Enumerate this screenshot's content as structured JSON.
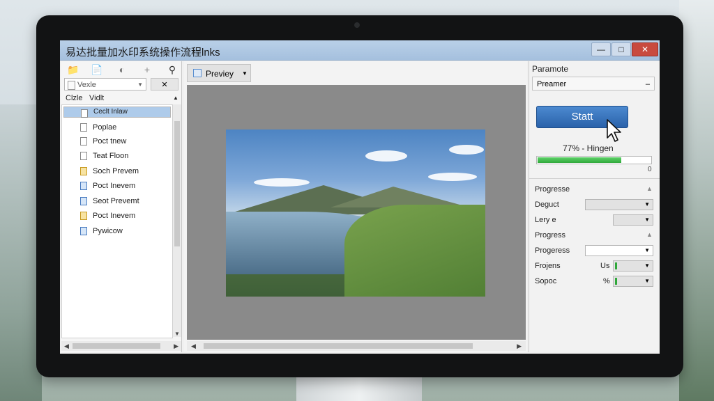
{
  "window": {
    "title": "易达批量加水印系统操作流程lnks",
    "min_label": "—",
    "max_label": "□",
    "close_label": "✕"
  },
  "left_panel": {
    "view_dropdown": "Vexle",
    "close_label": "✕",
    "col1": "Clzle",
    "col2": "Vidlt",
    "files": [
      {
        "label": "Ceclt Inlaw",
        "icon": "document-icon",
        "selected": true
      },
      {
        "label": "Poplae",
        "icon": "document-icon",
        "selected": false
      },
      {
        "label": "Poct tnew",
        "icon": "document-icon",
        "selected": false
      },
      {
        "label": "Teat Floon",
        "icon": "document-icon",
        "selected": false
      },
      {
        "label": "Soch Prevem",
        "icon": "image-file-icon",
        "selected": false
      },
      {
        "label": "Poct Inevem",
        "icon": "image-file-icon",
        "selected": false
      },
      {
        "label": "Seot Prevemt",
        "icon": "image-file-icon",
        "selected": false
      },
      {
        "label": "Poct Inevem",
        "icon": "image-file-icon",
        "selected": false
      },
      {
        "label": "Pywicow",
        "icon": "image-file-icon",
        "selected": false
      }
    ]
  },
  "center_panel": {
    "preview_tab": "Previey"
  },
  "right_panel": {
    "title": "Paramote",
    "param_dropdown": "Preamer",
    "start_button": "Statt",
    "progress_text": "77% - Hingen",
    "progress_fraction": 0.74,
    "progress_end": "0",
    "rows": [
      {
        "label": "Progresse",
        "value": ""
      },
      {
        "label": "Deguct",
        "value": ""
      },
      {
        "label": "Lery e",
        "value": ""
      },
      {
        "label": "Progress",
        "value": ""
      },
      {
        "label": "Progeress",
        "value": ""
      },
      {
        "label": "Frojens",
        "value": "Us"
      },
      {
        "label": "Sopoc",
        "value": "%"
      }
    ]
  },
  "colors": {
    "accent": "#2f6db6",
    "progress_green": "#2fa83a",
    "selection": "#aecbea"
  }
}
